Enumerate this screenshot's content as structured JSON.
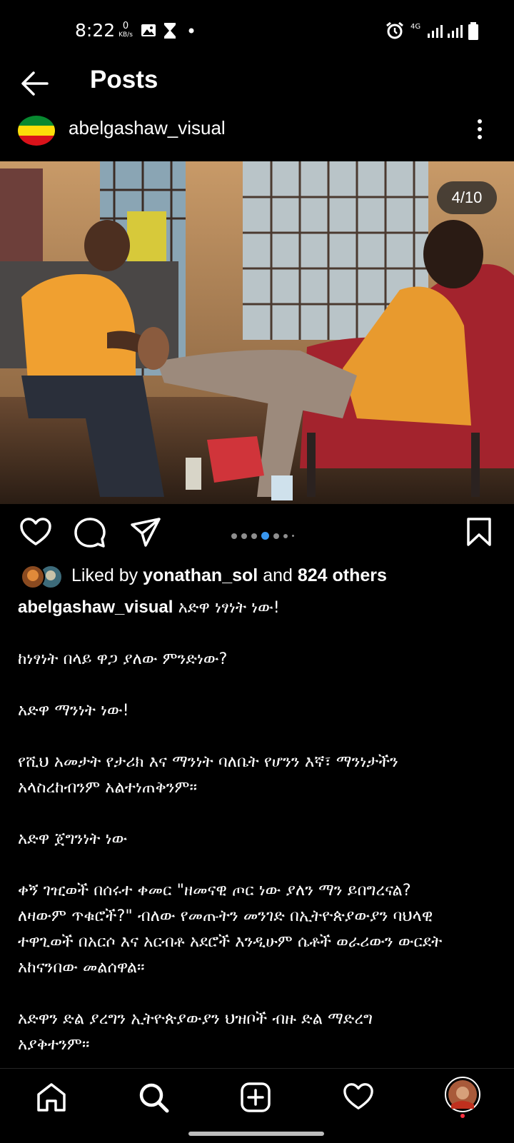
{
  "status_bar": {
    "time": "8:22",
    "data_rate_value": "0",
    "data_rate_unit": "KB/s",
    "network": "4G",
    "icons": [
      "image-icon",
      "hourglass-icon",
      "dot-icon",
      "alarm-icon",
      "signal-icon",
      "signal-icon",
      "battery-icon"
    ]
  },
  "header": {
    "title": "Posts",
    "back_icon": "arrow-left-icon",
    "username": "abelgashaw_visual",
    "more_icon": "more-vertical-icon",
    "avatar_colors": [
      "#078930",
      "#FCDD09",
      "#DA121A"
    ]
  },
  "post": {
    "image_counter": "4/10",
    "carousel": {
      "count": 7,
      "active_index": 3
    },
    "actions": {
      "like_icon": "heart-icon",
      "comment_icon": "comment-icon",
      "share_icon": "send-icon",
      "save_icon": "bookmark-icon"
    },
    "likes": {
      "prefix": "Liked by",
      "user": "yonathan_sol",
      "middle": "and",
      "others": "824 others"
    },
    "caption_user": "abelgashaw_visual",
    "caption_first": "አድዋ ነፃነት ነው!",
    "caption_paragraphs": [
      "ከነፃነት በላይ ዋጋ ያለው ምንድነው?",
      "አድዋ ማንነት ነው!",
      "የሺህ አመታት የታሪክ እና ማንነት ባለቤት የሆንን እኛ፣ ማንነታችን\nአላስረከብንም አልተነጠቅንም።",
      "አድዋ ጀግንነት ነው",
      "ቀኝ ገዢወች በሰሩተ ቀመር \"ዘመናዊ ጦር ነው ያለን ማን ይበግረናል?\nለዛውም ጥቁሮች?\" ብለው የመጡትን መንገድ በኢትዮጵያውያን ባህላዊ\nተዋጊወች በአርሶ እና አርብቶ አደሮች እንዲሁም ሴቶች ወራሪውን ውርደት\nአከናንበው መልሰዋል።",
      "አድዋን ድል ያረግን ኢትዮጵያውያን ህዝቦች ብዙ ድል ማድረግ\nአያቅተንም።"
    ]
  },
  "bottom_nav": {
    "items": [
      "home-icon",
      "search-icon",
      "create-icon",
      "activity-icon",
      "profile-icon"
    ],
    "accent": "#ff3040"
  }
}
